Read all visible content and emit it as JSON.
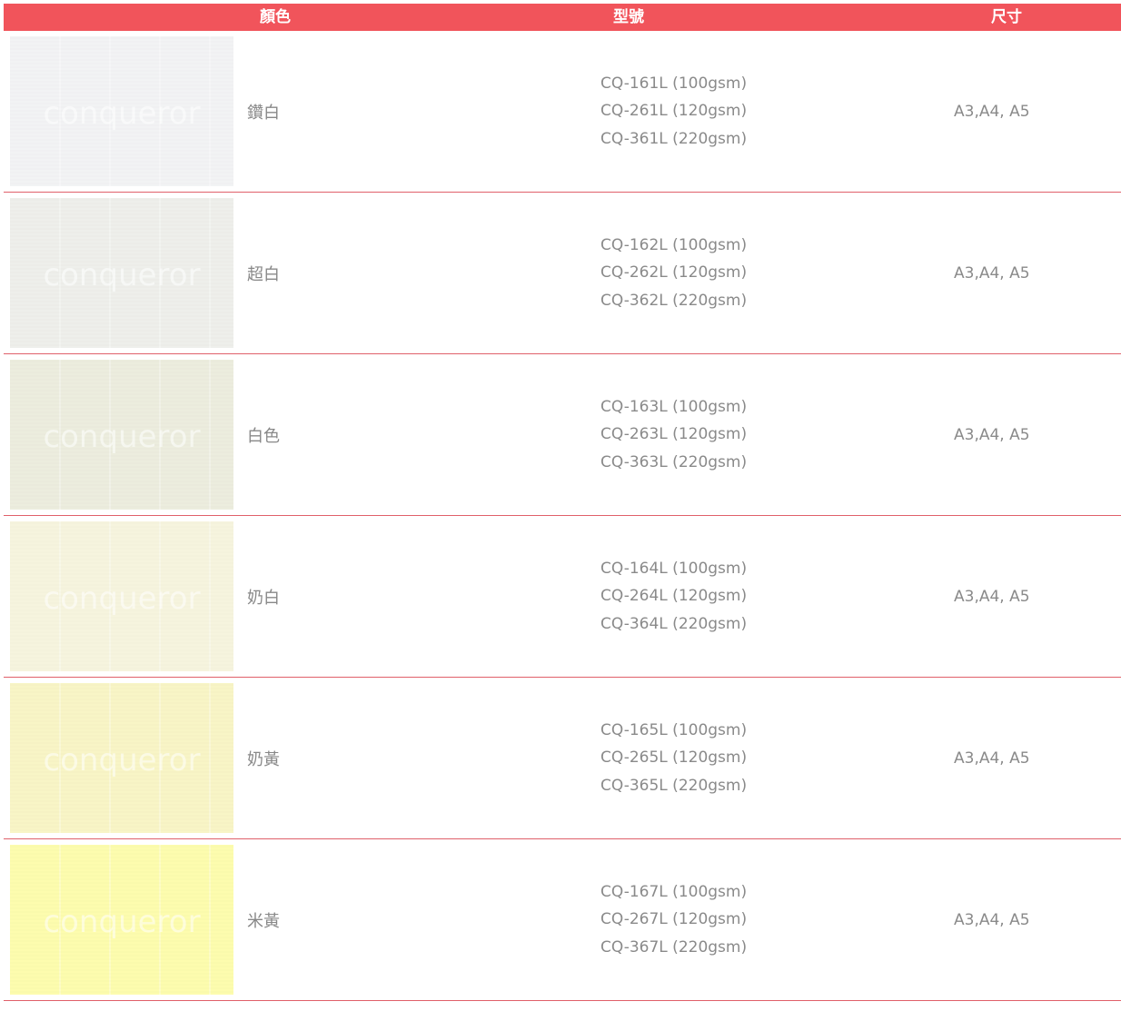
{
  "header": {
    "color": "顏色",
    "model": "型號",
    "size": "尺寸"
  },
  "swatch_watermark": "conqueror",
  "rows": [
    {
      "name": "鑽白",
      "swatch_color": "#f2f3f4",
      "models": [
        "CQ-161L (100gsm)",
        "CQ-261L (120gsm)",
        "CQ-361L (220gsm)"
      ],
      "sizes": "A3,A4, A5"
    },
    {
      "name": "超白",
      "swatch_color": "#eeefeb",
      "models": [
        "CQ-162L (100gsm)",
        "CQ-262L (120gsm)",
        "CQ-362L (220gsm)"
      ],
      "sizes": "A3,A4, A5"
    },
    {
      "name": "白色",
      "swatch_color": "#ecedde",
      "models": [
        "CQ-163L (100gsm)",
        "CQ-263L (120gsm)",
        "CQ-363L (220gsm)"
      ],
      "sizes": "A3,A4, A5"
    },
    {
      "name": "奶白",
      "swatch_color": "#f6f4de",
      "models": [
        "CQ-164L (100gsm)",
        "CQ-264L (120gsm)",
        "CQ-364L (220gsm)"
      ],
      "sizes": "A3,A4, A5"
    },
    {
      "name": "奶黃",
      "swatch_color": "#f8f5c6",
      "models": [
        "CQ-165L (100gsm)",
        "CQ-265L (120gsm)",
        "CQ-365L (220gsm)"
      ],
      "sizes": "A3,A4, A5"
    },
    {
      "name": "米黃",
      "swatch_color": "#fdfcae",
      "models": [
        "CQ-167L (100gsm)",
        "CQ-267L (120gsm)",
        "CQ-367L (220gsm)"
      ],
      "sizes": "A3,A4, A5"
    }
  ],
  "colors": {
    "header_bg": "#f1545b",
    "divider": "#e0606a"
  }
}
